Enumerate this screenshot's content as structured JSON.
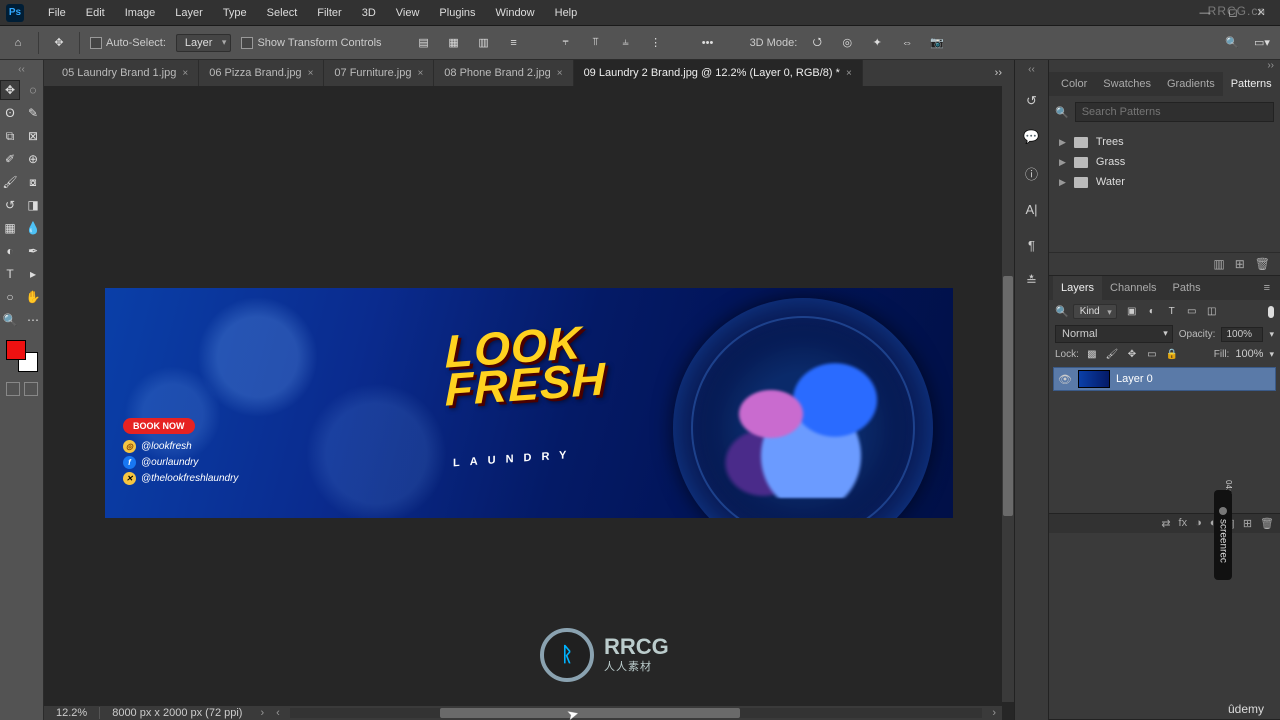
{
  "watermarks": {
    "topright": "RRCG.cn",
    "bottomright": "ûdemy",
    "center_brand": "RRCG",
    "center_sub": "人人素材",
    "screenrec": "screenrec",
    "timestamp": "04:18"
  },
  "menubar": {
    "items": [
      "File",
      "Edit",
      "Image",
      "Layer",
      "Type",
      "Select",
      "Filter",
      "3D",
      "View",
      "Plugins",
      "Window",
      "Help"
    ]
  },
  "optionsbar": {
    "auto_select": "Auto-Select:",
    "layer_select": "Layer",
    "show_transform": "Show Transform Controls",
    "mode3d": "3D Mode:"
  },
  "doctabs": [
    {
      "label": "05 Laundry Brand 1.jpg"
    },
    {
      "label": "06 Pizza Brand.jpg"
    },
    {
      "label": "07 Furniture.jpg"
    },
    {
      "label": "08 Phone Brand 2.jpg"
    },
    {
      "label": "09 Laundry 2 Brand.jpg @ 12.2% (Layer 0, RGB/8) *",
      "active": true
    }
  ],
  "statusbar": {
    "zoom": "12.2%",
    "docinfo": "8000 px x 2000 px (72 ppi)"
  },
  "banner": {
    "cta": "BOOK NOW",
    "title_line1": "LOOK",
    "title_line2": "FRESH",
    "subtitle": "LAUNDRY",
    "socials": [
      {
        "net": "ig",
        "handle": "@lookfresh"
      },
      {
        "net": "fb",
        "handle": "@ourlaundry"
      },
      {
        "net": "tw",
        "handle": "@thelookfreshlaundry"
      }
    ]
  },
  "patterns_panel": {
    "tabs": [
      "Color",
      "Swatches",
      "Gradients",
      "Patterns"
    ],
    "active_tab": "Patterns",
    "search_placeholder": "Search Patterns",
    "groups": [
      "Trees",
      "Grass",
      "Water"
    ]
  },
  "layers_panel": {
    "tabs": [
      "Layers",
      "Channels",
      "Paths"
    ],
    "active_tab": "Layers",
    "filter_kind": "Kind",
    "blend_mode": "Normal",
    "opacity_label": "Opacity:",
    "opacity_value": "100%",
    "lock_label": "Lock:",
    "fill_label": "Fill:",
    "fill_value": "100%",
    "layers": [
      {
        "name": "Layer 0",
        "visible": true
      }
    ]
  }
}
